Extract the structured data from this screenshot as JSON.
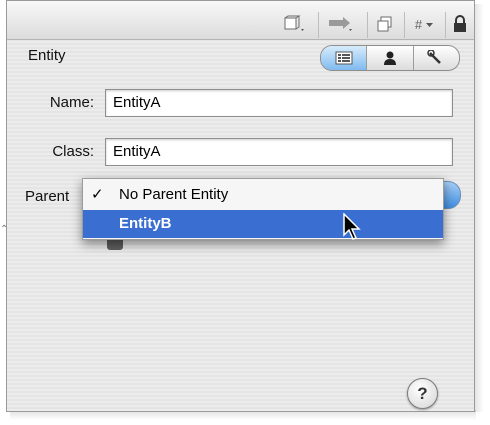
{
  "toolbar": {
    "icons": [
      "book-icon",
      "arrow-right-icon",
      "copy-icon",
      "hash-icon",
      "lock-icon"
    ],
    "hash_label": "#"
  },
  "entity": {
    "title": "Entity",
    "segments": [
      "general-pane-icon",
      "user-info-icon",
      "wrench-icon"
    ]
  },
  "form": {
    "name_label": "Name:",
    "name_value": "EntityA",
    "class_label": "Class:",
    "class_value": "EntityA",
    "parent_label": "Parent"
  },
  "menu": {
    "items": [
      {
        "check": "✓",
        "label": "No Parent Entity",
        "selected": false
      },
      {
        "check": "",
        "label": "EntityB",
        "selected": true
      }
    ]
  },
  "help": {
    "label": "?"
  }
}
